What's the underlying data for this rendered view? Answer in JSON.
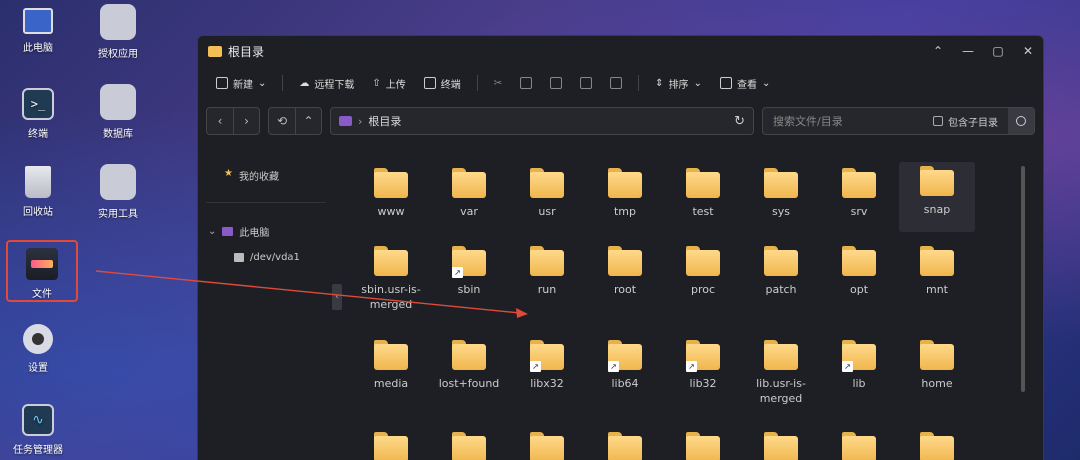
{
  "desktop": {
    "icons": [
      {
        "label": "此电脑"
      },
      {
        "label": "授权应用"
      },
      {
        "label": "终端"
      },
      {
        "label": "数据库"
      },
      {
        "label": "回收站"
      },
      {
        "label": "实用工具"
      },
      {
        "label": "文件"
      },
      {
        "label": "设置"
      },
      {
        "label": "任务管理器"
      }
    ]
  },
  "window": {
    "title": "根目录",
    "toolbar": {
      "new": "新建",
      "remote_download": "远程下载",
      "upload": "上传",
      "terminal": "终端",
      "sort": "排序",
      "view": "查看"
    },
    "address": {
      "path": "根目录"
    },
    "search": {
      "placeholder": "搜索文件/目录",
      "include_sub": "包含子目录"
    },
    "sidebar": {
      "favorites": "我的收藏",
      "computer": "此电脑",
      "drive": "/dev/vda1"
    },
    "folders": [
      {
        "name": "www"
      },
      {
        "name": "var"
      },
      {
        "name": "usr"
      },
      {
        "name": "tmp"
      },
      {
        "name": "test"
      },
      {
        "name": "sys"
      },
      {
        "name": "srv"
      },
      {
        "name": "snap"
      },
      {
        "name": "sbin.usr-is-merged"
      },
      {
        "name": "sbin"
      },
      {
        "name": "run"
      },
      {
        "name": "root"
      },
      {
        "name": "proc"
      },
      {
        "name": "patch"
      },
      {
        "name": "opt"
      },
      {
        "name": "mnt"
      },
      {
        "name": "media"
      },
      {
        "name": "lost+found"
      },
      {
        "name": "libx32"
      },
      {
        "name": "lib64"
      },
      {
        "name": "lib32"
      },
      {
        "name": "lib.usr-is-merged"
      },
      {
        "name": "lib"
      },
      {
        "name": "home"
      }
    ]
  },
  "colors": {
    "accent_red": "#e04a3a",
    "folder": "#f4bf57",
    "window_bg": "#1e1f24"
  }
}
